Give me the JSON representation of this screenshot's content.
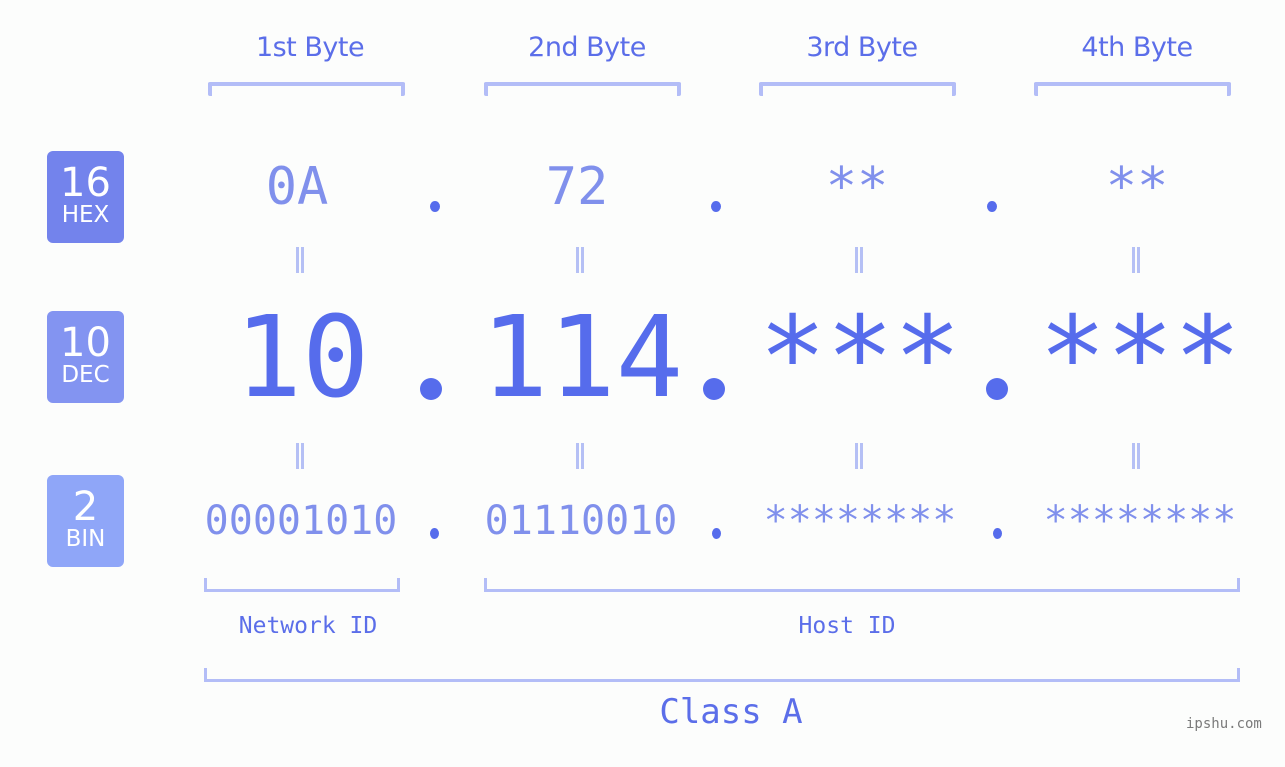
{
  "byte_headers": [
    "1st Byte",
    "2nd Byte",
    "3rd Byte",
    "4th Byte"
  ],
  "badges": {
    "hex": {
      "number": "16",
      "label": "HEX",
      "color": "#7383ec"
    },
    "dec": {
      "number": "10",
      "label": "DEC",
      "color": "#8394f1"
    },
    "bin": {
      "number": "2",
      "label": "BIN",
      "color": "#8fa6f8"
    }
  },
  "hex_values": [
    "0A",
    "72",
    "**",
    "**"
  ],
  "dec_values": [
    "10",
    "114",
    "***",
    "***"
  ],
  "bin_values": [
    "00001010",
    "01110010",
    "********",
    "********"
  ],
  "separator": ".",
  "equals_symbol": "=",
  "network_label": "Network ID",
  "host_label": "Host ID",
  "class_label": "Class A",
  "watermark": "ipshu.com",
  "colors": {
    "primary_text": "#566cec",
    "secondary_text": "#8090ec",
    "bracket": "#b3bdf7",
    "background": "#fcfdfc"
  }
}
